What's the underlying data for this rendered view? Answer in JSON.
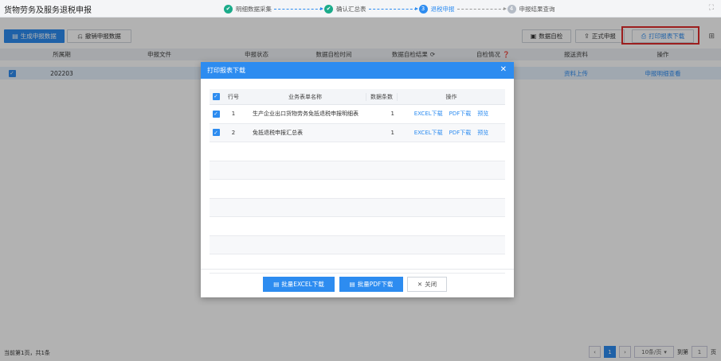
{
  "header": {
    "title": "货物劳务及服务退税申报",
    "steps": [
      {
        "num": "✔",
        "label": "明细数据采集"
      },
      {
        "num": "✔",
        "label": "确认汇总表"
      },
      {
        "num": "3",
        "label": "退税申报"
      },
      {
        "num": "4",
        "label": "申报结果查询"
      }
    ]
  },
  "toolbar": {
    "generate_label": "生成申报数据",
    "revoke_label": "撤销申报数据",
    "self_check_label": "数据自检",
    "formal_label": "正式申报",
    "print_label": "打印报表下载"
  },
  "table": {
    "columns": [
      "所属期",
      "申报文件",
      "申报状态",
      "数据自检时间",
      "数据自检结果",
      "自检情况",
      "报送资料",
      "操作"
    ],
    "rows": [
      {
        "period": "202203",
        "material": "资料上传",
        "action": "申报明细查看"
      }
    ]
  },
  "modal": {
    "title": "打印报表下载",
    "columns": {
      "no": "行号",
      "name": "业务表单名称",
      "count": "数据条数",
      "ops": "操作"
    },
    "rows": [
      {
        "no": "1",
        "name": "生产企业出口货物劳务免抵退税申报明细表",
        "count": "1",
        "excel": "EXCEL下载",
        "pdf": "PDF下载",
        "preview": "预览"
      },
      {
        "no": "2",
        "name": "免抵退税申报汇总表",
        "count": "1",
        "excel": "EXCEL下载",
        "pdf": "PDF下载",
        "preview": "预览"
      }
    ],
    "batch_excel_label": "批量EXCEL下载",
    "batch_pdf_label": "批量PDF下载",
    "close_label": "关闭"
  },
  "footer": {
    "info": "当前第1页，共1条",
    "current_page": "1",
    "page_size": "10条/页",
    "goto_label": "到第",
    "goto_value": "1",
    "page_unit": "页"
  },
  "colors": {
    "accent": "#2d8cf0",
    "done": "#1aab8a",
    "highlight": "#e02b2b"
  }
}
